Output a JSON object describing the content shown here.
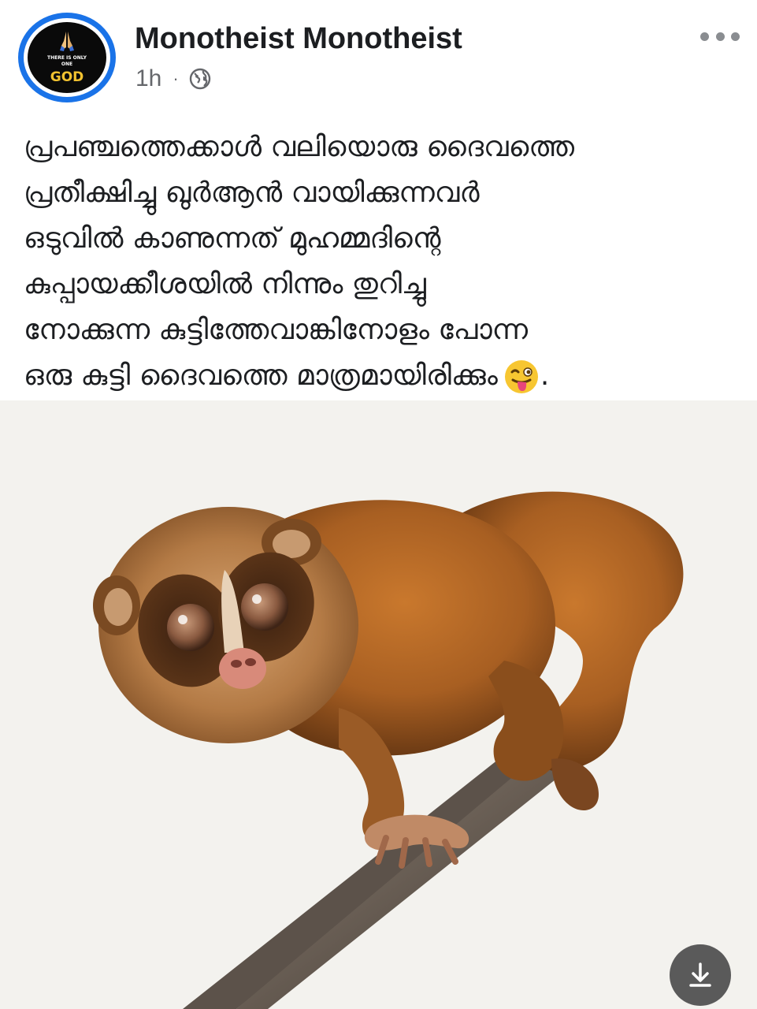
{
  "post": {
    "author": "Monotheist Monotheist",
    "timestamp": "1h",
    "separator": "·",
    "audience_icon": "globe-icon",
    "more_icon": "more-options-icon",
    "avatar": {
      "line1": "THERE IS ONLY",
      "line2": "ONE",
      "line3": "GOD",
      "icon": "praying-hands-icon"
    },
    "text_lines": [
      "പ്രപഞ്ചത്തെക്കാൾ വലിയൊരു ദൈവത്തെ",
      "പ്രതീക്ഷിച്ചു ഖുർആൻ വായിക്കുന്നവർ",
      "ഒടുവിൽ കാണുന്നത് മുഹമ്മദിന്റെ",
      "കുപ്പായക്കീശയിൽ നിന്നും  തുറിച്ചു",
      "നോക്കുന്ന  കുട്ടിത്തേവാങ്കിനോളം പോന്ന",
      "ഒരു കുട്ടി ദൈവത്തെ  മാത്രമായിരിക്കും"
    ],
    "text_end_punct": ".",
    "emoji_icon": "winking-tongue-emoji-icon",
    "photo_subject": "slender-loris-photo",
    "download_icon": "download-icon"
  }
}
